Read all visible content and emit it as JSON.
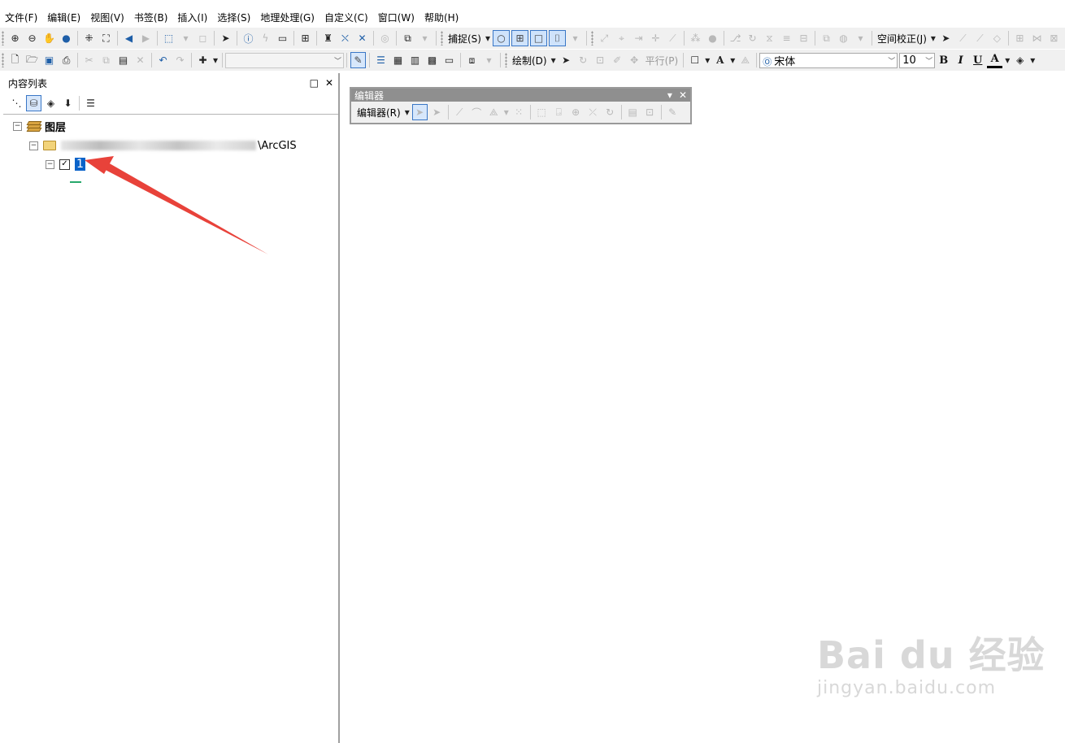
{
  "menu": [
    "文件(F)",
    "编辑(E)",
    "视图(V)",
    "书签(B)",
    "插入(I)",
    "选择(S)",
    "地理处理(G)",
    "自定义(C)",
    "窗口(W)",
    "帮助(H)"
  ],
  "toolbar1": {
    "snap_label": "捕捉(S)",
    "georef_label": "空间校正(J)"
  },
  "toolbar2": {
    "draw_label": "绘制(D)",
    "parallel_label": "平行(P)",
    "font_name": "宋体",
    "font_size": "10",
    "bold": "B",
    "italic": "I",
    "underline": "U",
    "font_color": "A"
  },
  "toc": {
    "title": "内容列表",
    "layers_label": "图层",
    "folder_suffix": "\\ArcGIS",
    "layer_name": "1"
  },
  "editor": {
    "title": "编辑器",
    "menu_label": "编辑器(R)"
  },
  "watermark": {
    "logo": "Bai du 经验",
    "url": "jingyan.baidu.com"
  },
  "colors": {
    "selection": "#0b63c9",
    "annotation_arrow": "#e8423a",
    "toolbar_bg": "#f0f0f0"
  }
}
